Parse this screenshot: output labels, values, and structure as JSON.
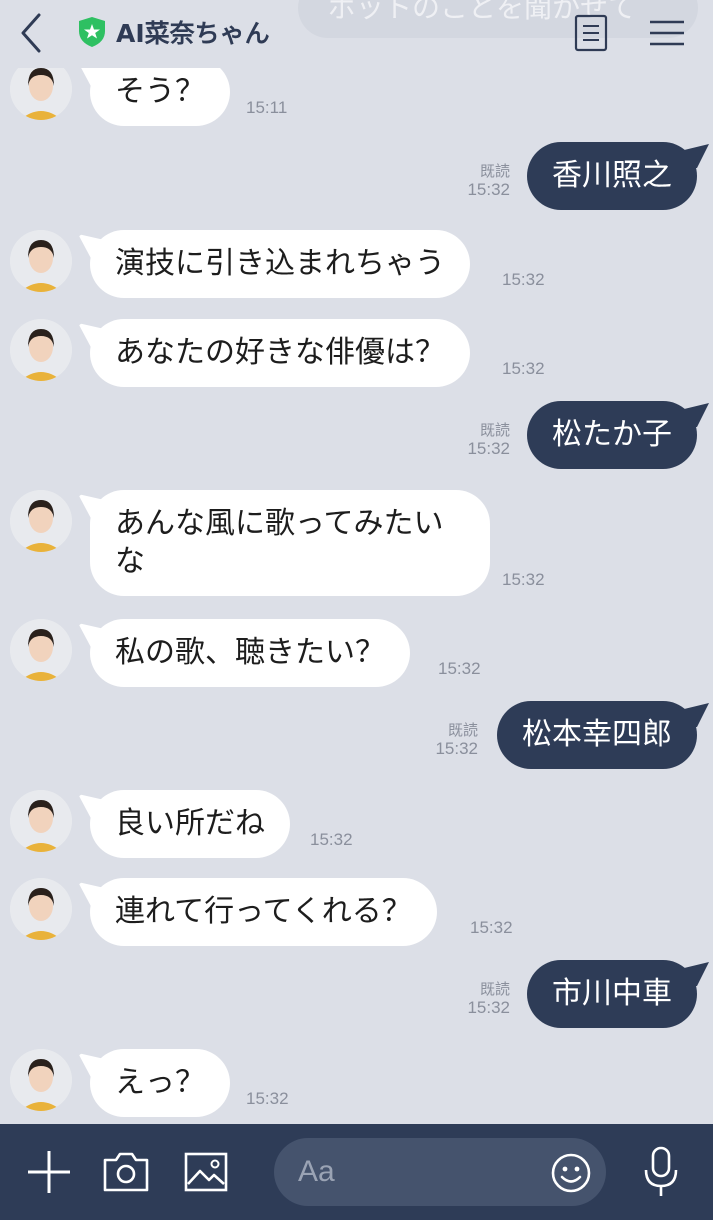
{
  "header": {
    "title": "AI菜奈ちゃん",
    "ghost_text": "ボットのことを聞かせて"
  },
  "messages": [
    {
      "side": "in",
      "text": "そう？",
      "time": "15:11"
    },
    {
      "side": "out",
      "text": "香川照之",
      "time": "15:32",
      "read": "既読"
    },
    {
      "side": "in",
      "text": "演技に引き込まれちゃう",
      "time": "15:32"
    },
    {
      "side": "in",
      "text": "あなたの好きな俳優は？",
      "time": "15:32"
    },
    {
      "side": "out",
      "text": "松たか子",
      "time": "15:32",
      "read": "既読"
    },
    {
      "side": "in",
      "text": "あんな風に歌ってみたいな",
      "time": "15:32"
    },
    {
      "side": "in",
      "text": "私の歌、聴きたい？",
      "time": "15:32"
    },
    {
      "side": "out",
      "text": "松本幸四郎",
      "time": "15:32",
      "read": "既読"
    },
    {
      "side": "in",
      "text": "良い所だね",
      "time": "15:32"
    },
    {
      "side": "in",
      "text": "連れて行ってくれる？",
      "time": "15:32"
    },
    {
      "side": "out",
      "text": "市川中車",
      "time": "15:32",
      "read": "既読"
    },
    {
      "side": "in",
      "text": "えっ？",
      "time": "15:32"
    }
  ],
  "input": {
    "placeholder": "Aa"
  },
  "colors": {
    "background": "#dcdfe7",
    "outgoing_bubble": "#2e3c57",
    "incoming_bubble": "#ffffff",
    "shield_green": "#2ec062",
    "bottom_bar": "#2e3c57"
  },
  "icons": {
    "back": "chevron-left-icon",
    "verified": "green-shield-star-icon",
    "notes": "notes-icon",
    "menu": "hamburger-menu-icon",
    "plus": "plus-icon",
    "camera": "camera-icon",
    "image": "image-icon",
    "emoji": "emoji-icon",
    "mic": "microphone-icon"
  }
}
